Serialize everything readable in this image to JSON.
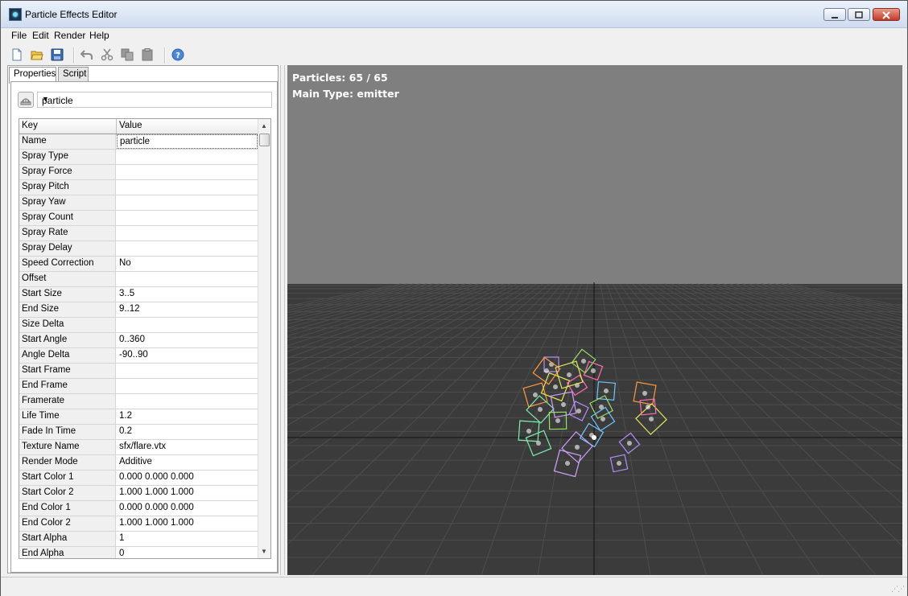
{
  "window": {
    "title": "Particle Effects Editor"
  },
  "menu": [
    "File",
    "Edit",
    "Render",
    "Help"
  ],
  "toolbar": {
    "icons": [
      "new-file-icon",
      "open-folder-icon",
      "save-icon",
      "undo-icon",
      "cut-icon",
      "copy-icon",
      "paste-icon",
      "help-icon"
    ]
  },
  "tabs": [
    {
      "label": "Properties",
      "active": true
    },
    {
      "label": "Script",
      "active": false
    }
  ],
  "selector": {
    "value": "particle"
  },
  "grid": {
    "columns": [
      "Key",
      "Value"
    ],
    "rows": [
      {
        "key": "Name",
        "value": "particle"
      },
      {
        "key": "Spray Type",
        "value": ""
      },
      {
        "key": "Spray Force",
        "value": ""
      },
      {
        "key": "Spray Pitch",
        "value": ""
      },
      {
        "key": "Spray Yaw",
        "value": ""
      },
      {
        "key": "Spray Count",
        "value": ""
      },
      {
        "key": "Spray Rate",
        "value": ""
      },
      {
        "key": "Spray Delay",
        "value": ""
      },
      {
        "key": "Speed Correction",
        "value": "No"
      },
      {
        "key": "Offset",
        "value": ""
      },
      {
        "key": "Start Size",
        "value": "3..5"
      },
      {
        "key": "End Size",
        "value": "9..12"
      },
      {
        "key": "Size Delta",
        "value": ""
      },
      {
        "key": "Start Angle",
        "value": "0..360"
      },
      {
        "key": "Angle Delta",
        "value": "-90..90"
      },
      {
        "key": "Start Frame",
        "value": ""
      },
      {
        "key": "End Frame",
        "value": ""
      },
      {
        "key": "Framerate",
        "value": ""
      },
      {
        "key": "Life Time",
        "value": "1.2"
      },
      {
        "key": "Fade In Time",
        "value": "0.2"
      },
      {
        "key": "Texture Name",
        "value": "sfx/flare.vtx"
      },
      {
        "key": "Render Mode",
        "value": "Additive"
      },
      {
        "key": "Start Color 1",
        "value": "0.000 0.000 0.000"
      },
      {
        "key": "Start Color 2",
        "value": "1.000 1.000 1.000"
      },
      {
        "key": "End Color 1",
        "value": "0.000 0.000 0.000"
      },
      {
        "key": "End Color 2",
        "value": "1.000 1.000 1.000"
      },
      {
        "key": "Start Alpha",
        "value": "1"
      },
      {
        "key": "End Alpha",
        "value": "0"
      }
    ]
  },
  "viewport": {
    "particles_label": "Particles: 65 / 65",
    "main_type_label": "Main Type: emitter",
    "sky_color": "#7f7f7f",
    "floor_color": "#3b3b3b",
    "grid_line_color": "#4d4d4d",
    "axis_color": "#111111"
  }
}
